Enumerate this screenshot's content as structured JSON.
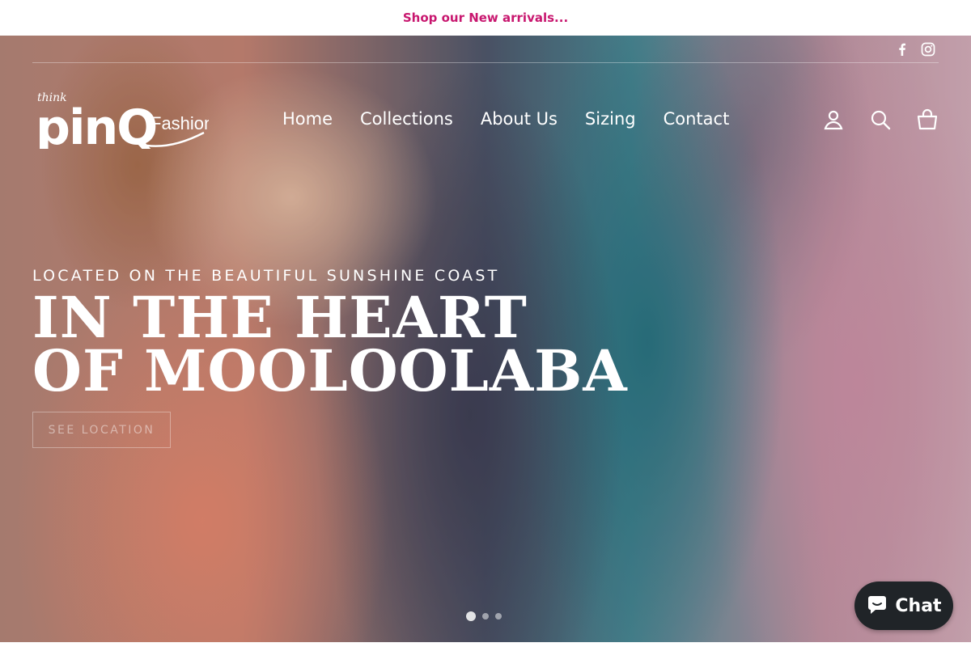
{
  "announcement": {
    "text": "Shop our New arrivals..."
  },
  "social": {
    "icons": [
      "facebook-icon",
      "instagram-icon"
    ]
  },
  "logo": {
    "small_text": "think",
    "brand_text": "pinQ",
    "suffix_text": "Fashions"
  },
  "nav": {
    "items": [
      {
        "label": "Home"
      },
      {
        "label": "Collections"
      },
      {
        "label": "About Us"
      },
      {
        "label": "Sizing"
      },
      {
        "label": "Contact"
      }
    ]
  },
  "header_actions": {
    "icons": [
      "account-icon",
      "search-icon",
      "cart-icon"
    ]
  },
  "hero": {
    "subtitle": "LOCATED ON THE BEAUTIFUL SUNSHINE COAST",
    "headline_line1": "IN THE HEART",
    "headline_line2": "OF MOOLOOLABA",
    "cta_label": "SEE LOCATION",
    "slides_total": 3,
    "active_slide": 1
  },
  "chat_widget": {
    "label": "Chat",
    "icon": "chat-bubble-icon"
  },
  "colors": {
    "announcement_text": "#c8176f",
    "chat_bg": "#202428",
    "hero_text": "#ffffff"
  }
}
